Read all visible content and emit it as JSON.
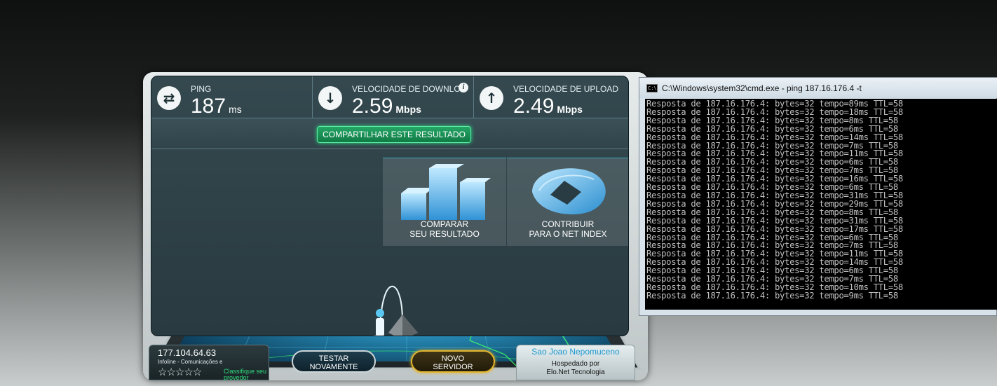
{
  "speedtest": {
    "ping": {
      "label": "PING",
      "value": "187",
      "unit": "ms",
      "icon": "ping-arrows-icon"
    },
    "download": {
      "label": "VELOCIDADE DE DOWNLOAD",
      "value": "2.59",
      "unit": "Mbps",
      "icon": "download-arrow-icon",
      "info": "i"
    },
    "upload": {
      "label": "VELOCIDADE DE UPLOAD",
      "value": "2.49",
      "unit": "Mbps",
      "icon": "upload-arrow-icon"
    },
    "share_label": "COMPARTILHAR ESTE RESULTADO",
    "compare": {
      "line1": "COMPARAR",
      "line2": "SEU RESULTADO"
    },
    "contribute": {
      "line1": "CONTRIBUIR",
      "line2": "PARA O NET INDEX"
    },
    "client": {
      "ip": "177.104.64.63",
      "isp": "Infoline - Comunicações e",
      "rate_label": "Classifique seu provedor",
      "stars": 0
    },
    "test_again": {
      "line1": "TESTAR",
      "line2": "NOVAMENTE"
    },
    "new_server": {
      "line1": "NOVO",
      "line2": "SERVIDOR"
    },
    "server": {
      "city": "Sao Joao Nepomuceno",
      "hosted_by": "Hospedado por",
      "host": "Elo.Net Tecnologia"
    },
    "colors": {
      "accent_green": "#22c36f",
      "accent_gold": "#e2b52e",
      "cyan": "#46c9ee"
    }
  },
  "cmd": {
    "title": "C:\\Windows\\system32\\cmd.exe - ping  187.16.176.4 -t",
    "lines": [
      "Resposta de 187.16.176.4: bytes=32 tempo=89ms TTL=58",
      "Resposta de 187.16.176.4: bytes=32 tempo=18ms TTL=58",
      "Resposta de 187.16.176.4: bytes=32 tempo=8ms TTL=58",
      "Resposta de 187.16.176.4: bytes=32 tempo=6ms TTL=58",
      "Resposta de 187.16.176.4: bytes=32 tempo=14ms TTL=58",
      "Resposta de 187.16.176.4: bytes=32 tempo=7ms TTL=58",
      "Resposta de 187.16.176.4: bytes=32 tempo=11ms TTL=58",
      "Resposta de 187.16.176.4: bytes=32 tempo=6ms TTL=58",
      "Resposta de 187.16.176.4: bytes=32 tempo=7ms TTL=58",
      "Resposta de 187.16.176.4: bytes=32 tempo=16ms TTL=58",
      "Resposta de 187.16.176.4: bytes=32 tempo=6ms TTL=58",
      "Resposta de 187.16.176.4: bytes=32 tempo=31ms TTL=58",
      "Resposta de 187.16.176.4: bytes=32 tempo=29ms TTL=58",
      "Resposta de 187.16.176.4: bytes=32 tempo=8ms TTL=58",
      "Resposta de 187.16.176.4: bytes=32 tempo=31ms TTL=58",
      "Resposta de 187.16.176.4: bytes=32 tempo=17ms TTL=58",
      "Resposta de 187.16.176.4: bytes=32 tempo=6ms TTL=58",
      "Resposta de 187.16.176.4: bytes=32 tempo=7ms TTL=58",
      "Resposta de 187.16.176.4: bytes=32 tempo=11ms TTL=58",
      "Resposta de 187.16.176.4: bytes=32 tempo=14ms TTL=58",
      "Resposta de 187.16.176.4: bytes=32 tempo=6ms TTL=58",
      "Resposta de 187.16.176.4: bytes=32 tempo=7ms TTL=58",
      "Resposta de 187.16.176.4: bytes=32 tempo=10ms TTL=58",
      "Resposta de 187.16.176.4: bytes=32 tempo=9ms TTL=58"
    ]
  }
}
